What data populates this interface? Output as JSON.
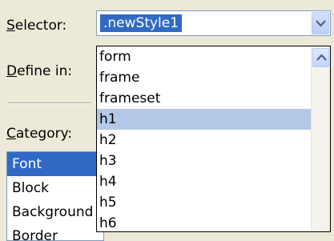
{
  "labels": {
    "selector_prefix": "S",
    "selector_rest": "elector:",
    "define_prefix": "D",
    "define_rest": "efine in:",
    "category_prefix": "C",
    "category_rest": "ategory:"
  },
  "selector": {
    "value": ".newStyle1",
    "dropdown_icon": "chevron-down-icon"
  },
  "dropdown": {
    "items": [
      "form",
      "frame",
      "frameset",
      "h1",
      "h2",
      "h3",
      "h4",
      "h5",
      "h6"
    ],
    "highlighted": "h1",
    "scroll_icon": "chevron-up-icon"
  },
  "category": {
    "items": [
      "Font",
      "Block",
      "Background",
      "Border"
    ],
    "selected": "Font"
  },
  "colors": {
    "selection": "#316ac5",
    "hover": "#b4c8e8",
    "window_bg": "#ece9d8"
  }
}
